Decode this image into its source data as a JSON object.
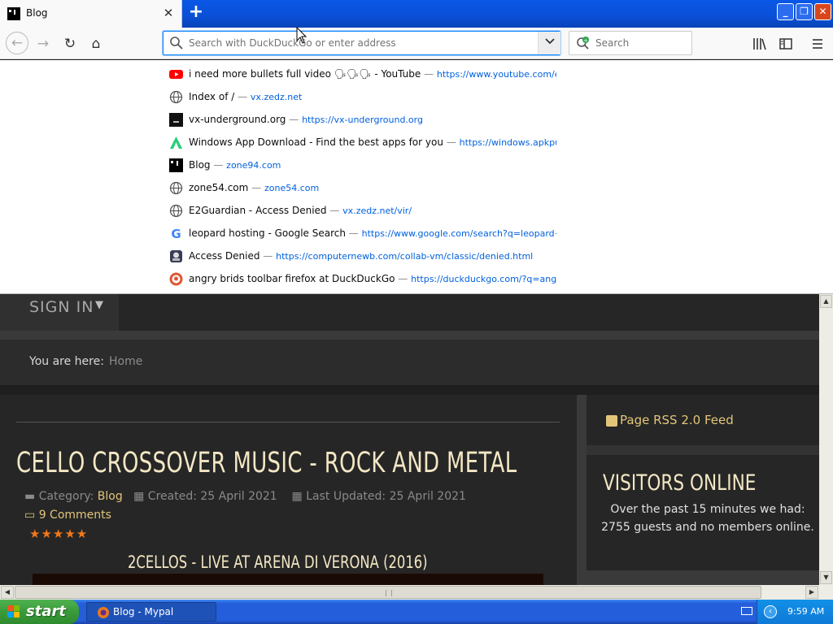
{
  "browser": {
    "tab": {
      "title": "Blog",
      "close_glyph": "✕"
    },
    "new_tab_glyph": "+",
    "window_controls": {
      "minimize": "_",
      "maximize": "❐",
      "close": "✕"
    },
    "nav": {
      "back": "←",
      "forward": "→",
      "reload": "↻",
      "home": "⌂"
    },
    "urlbar": {
      "placeholder": "Search with DuckDuckGo or enter address",
      "value": ""
    },
    "searchbar": {
      "placeholder": "Search"
    },
    "toolbar": {
      "library": "|||\\",
      "sidebar": "◧",
      "menu": "≡"
    }
  },
  "autocomplete": [
    {
      "icon": "youtube-icon",
      "title": "i need more bullets full video 🗣🗣🗣 - YouTube",
      "url": "https://www.youtube.com/embe"
    },
    {
      "icon": "globe-icon",
      "title": "Index of /",
      "url": "vx.zedz.net"
    },
    {
      "icon": "vx-icon",
      "title": "vx-underground.org",
      "url": "https://vx-underground.org"
    },
    {
      "icon": "apkpure-icon",
      "title": "Windows App Download - Find the best apps for you",
      "url": "https://windows.apkpure."
    },
    {
      "icon": "blog-icon",
      "title": "Blog",
      "url": "zone94.com"
    },
    {
      "icon": "globe-icon",
      "title": "zone54.com",
      "url": "zone54.com"
    },
    {
      "icon": "globe-icon",
      "title": "E2Guardian - Access Denied",
      "url": "vx.zedz.net/vir/"
    },
    {
      "icon": "google-icon",
      "title": "leopard hosting - Google Search",
      "url": "https://www.google.com/search?q=leopard+hosti"
    },
    {
      "icon": "computernewb-icon",
      "title": "Access Denied",
      "url": "https://computernewb.com/collab-vm/classic/denied.html"
    },
    {
      "icon": "duckduckgo-icon",
      "title": "angry brids toolbar firefox at DuckDuckGo",
      "url": "https://duckduckgo.com/?q=angry+brid"
    }
  ],
  "separator": "—",
  "page": {
    "signin": "SIGN IN",
    "breadcrumb": {
      "label": "You are here:",
      "home": "Home"
    },
    "article": {
      "title": "CELLO CROSSOVER MUSIC - ROCK AND METAL",
      "category_label": "Category:",
      "category": "Blog",
      "created": "Created: 25 April 2021",
      "updated": "Last Updated: 25 April 2021",
      "comments": "9 Comments",
      "rating": 5,
      "stars": "★★★★★",
      "video_title": "2CELLOS - LIVE AT ARENA DI VERONA (2016)"
    },
    "sidebar": {
      "rss": "Page RSS 2.0 Feed",
      "visitors_title": "VISITORS ONLINE",
      "visitors_text": "Over the past 15 minutes we had: 2755 guests and no members online."
    }
  },
  "taskbar": {
    "start": "start",
    "task": "Blog - Mypal",
    "clock": "9:59 AM"
  },
  "colors": {
    "accent": "#e3c57a",
    "heading": "#f3e7c4",
    "link": "#0060df",
    "xp_blue": "#245edb"
  }
}
